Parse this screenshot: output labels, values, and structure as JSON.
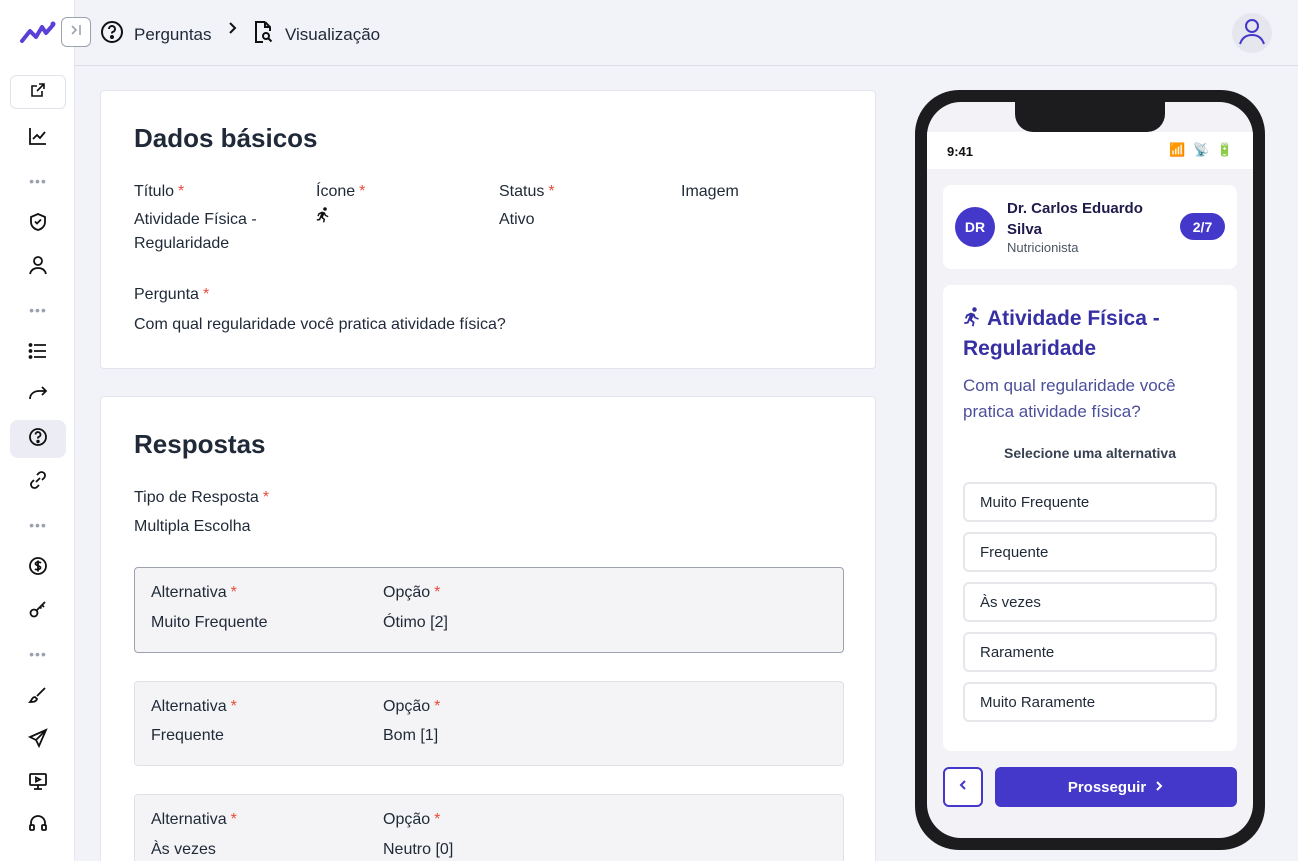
{
  "header": {
    "crumb1": "Perguntas",
    "crumb2": "Visualização"
  },
  "basic": {
    "title": "Dados básicos",
    "fields": {
      "titulo_label": "Título",
      "titulo_value": "Atividade Física - Regularidade",
      "icone_label": "Ícone",
      "status_label": "Status",
      "status_value": "Ativo",
      "imagem_label": "Imagem",
      "pergunta_label": "Pergunta",
      "pergunta_value": "Com qual regularidade você pratica atividade física?"
    },
    "required_mark": "*"
  },
  "answers": {
    "title": "Respostas",
    "type_label": "Tipo de Resposta",
    "type_value": "Multipla Escolha",
    "alt_label": "Alternativa",
    "opt_label": "Opção",
    "items": [
      {
        "alternativa": "Muito Frequente",
        "opcao": "Ótimo [2]"
      },
      {
        "alternativa": "Frequente",
        "opcao": "Bom [1]"
      },
      {
        "alternativa": "Às vezes",
        "opcao": "Neutro [0]"
      }
    ]
  },
  "phone": {
    "time": "9:41",
    "status_icons": "📶 📡 🔋",
    "professional": {
      "initials": "DR",
      "name": "Dr. Carlos Eduardo Silva",
      "role": "Nutricionista",
      "step": "2/7"
    },
    "question_title": "Atividade Física - Regularidade",
    "question_text": "Com qual regularidade você pratica atividade física?",
    "hint": "Selecione uma alternativa",
    "options": [
      "Muito Frequente",
      "Frequente",
      "Às vezes",
      "Raramente",
      "Muito Raramente"
    ],
    "next_label": "Prosseguir"
  },
  "colors": {
    "accent": "#4338ca",
    "required": "#e74c3c",
    "logo": "#5b3fd6"
  },
  "icons": {
    "sidebar": [
      "external-link-icon",
      "chart-line-icon",
      "shield-heart-icon",
      "user-icon",
      "list-icon",
      "forward-arrow-icon",
      "help-circle-icon",
      "link-icon",
      "dollar-icon",
      "key-icon",
      "brush-icon",
      "send-icon",
      "presentation-icon",
      "headset-icon"
    ]
  }
}
